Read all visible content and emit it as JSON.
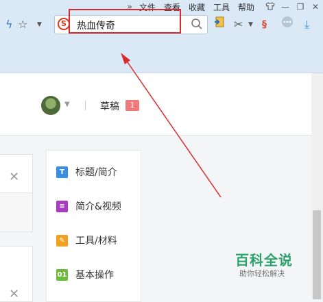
{
  "menu": {
    "items": [
      "文件",
      "查看",
      "收藏",
      "工具",
      "帮助"
    ],
    "overflow_icon": "double-chevron-right-icon"
  },
  "search": {
    "value": "热血传奇",
    "engine_logo": "S"
  },
  "header": {
    "drafts_label": "草稿",
    "drafts_count": "1"
  },
  "step_nav": {
    "items": [
      {
        "icon_text": "T",
        "label": "标题/简介",
        "color": "#3b8fe0"
      },
      {
        "icon_text": "≡",
        "label": "简介&视频",
        "color": "#a83bbf"
      },
      {
        "icon_text": "✎",
        "label": "工具/材料",
        "color": "#f0a11e"
      },
      {
        "icon_text": "01",
        "label": "基本操作",
        "color": "#6dbb3a"
      }
    ]
  },
  "watermark": {
    "title": "百科全说",
    "subtitle": "助你轻松解决"
  },
  "colors": {
    "annotation_red": "#d92b2b",
    "toolbar_bg": "#dbe8f6",
    "badge_bg": "#f07a7a",
    "watermark_green": "#2aa36b"
  }
}
